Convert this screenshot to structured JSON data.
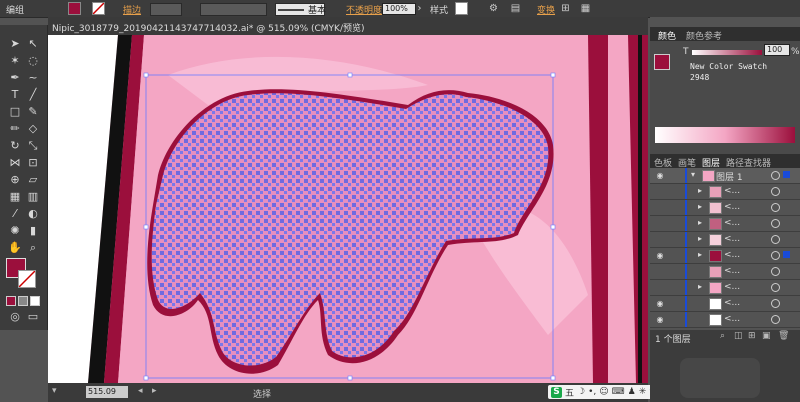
{
  "control_bar": {
    "selection_label": "编组",
    "stroke_label": "描边",
    "brush_label": "基本",
    "opacity_label": "不透明度",
    "opacity_value": "100%",
    "style_label": "样式",
    "transform_label": "变换",
    "fill_color": "#9b0f3c"
  },
  "document": {
    "tab_title": "Nipic_3018779_20190421143747714032.ai* @ 515.09% (CMYK/预览)",
    "zoom": "515.09",
    "status_mode": "选择",
    "canvas_bg": "#f4a6c4"
  },
  "ime": {
    "label": "五"
  },
  "color_panel": {
    "tabs": [
      "颜色",
      "颜色参考"
    ],
    "channel": "T",
    "value": "100",
    "unit": "%",
    "swatch_name": "New Color Swatch",
    "swatch_number": "2948",
    "accent": "#9b0f3c"
  },
  "layers_panel": {
    "tabs": [
      "色板",
      "画笔",
      "图层",
      "路径查找器"
    ],
    "layer_name": "图层 1",
    "rows": [
      {
        "name": "<...",
        "color": "#e8a0b8"
      },
      {
        "name": "<...",
        "color": "#f2c0d0"
      },
      {
        "name": "<...",
        "color": "#c06080"
      },
      {
        "name": "<...",
        "color": "#f6d0dc"
      },
      {
        "name": "<...",
        "color": "#9b0f3c"
      },
      {
        "name": "<...",
        "color": "#e8a0b8"
      },
      {
        "name": "<...",
        "color": "#f4a6c4"
      },
      {
        "name": "<...",
        "color": "#ffffff"
      },
      {
        "name": "<...",
        "color": "#ffffff"
      }
    ],
    "footer": "1 个图层"
  },
  "toolbar": {
    "fill": "#9b0f3c",
    "stroke": "#ffffff"
  }
}
